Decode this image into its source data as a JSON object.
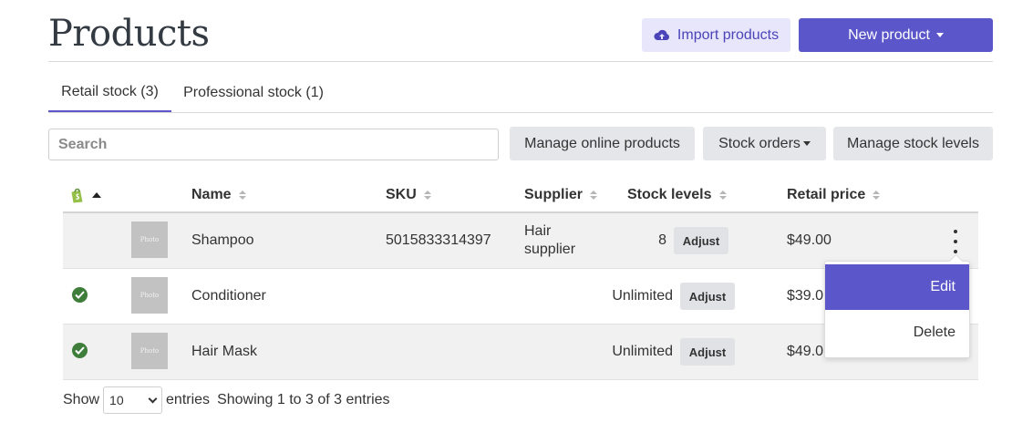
{
  "page": {
    "title": "Products"
  },
  "header": {
    "import_label": "Import products",
    "new_label": "New product"
  },
  "tabs": [
    {
      "label": "Retail stock (3)",
      "active": true
    },
    {
      "label": "Professional stock (1)",
      "active": false
    }
  ],
  "toolbar": {
    "search_placeholder": "Search",
    "manage_online_label": "Manage online products",
    "stock_orders_label": "Stock orders",
    "manage_levels_label": "Manage stock levels"
  },
  "table": {
    "columns": [
      "Name",
      "SKU",
      "Supplier",
      "Stock levels",
      "Retail price"
    ],
    "rows": [
      {
        "photo": "Photo",
        "name": "Shampoo",
        "sku": "5015833314397",
        "supplier_line1": "Hair",
        "supplier_line2": "supplier",
        "stock": "8",
        "adjust": "Adjust",
        "price": "$49.00",
        "online": false
      },
      {
        "photo": "Photo",
        "name": "Conditioner",
        "sku": "",
        "supplier_line1": "",
        "supplier_line2": "",
        "stock": "Unlimited",
        "adjust": "Adjust",
        "price": "$39.0",
        "online": true
      },
      {
        "photo": "Photo",
        "name": "Hair Mask",
        "sku": "",
        "supplier_line1": "",
        "supplier_line2": "",
        "stock": "Unlimited",
        "adjust": "Adjust",
        "price": "$49.0",
        "online": true
      }
    ]
  },
  "row_menu": {
    "edit_label": "Edit",
    "delete_label": "Delete"
  },
  "footer": {
    "show_label": "Show",
    "page_size": "10",
    "entries_label": "entries",
    "info": "Showing 1 to 3 of 3 entries"
  },
  "colors": {
    "accent": "#5b56c9",
    "accent_light": "#e8e6fb",
    "online_green": "#3e7d3a",
    "shopify_green": "#95bf47"
  }
}
